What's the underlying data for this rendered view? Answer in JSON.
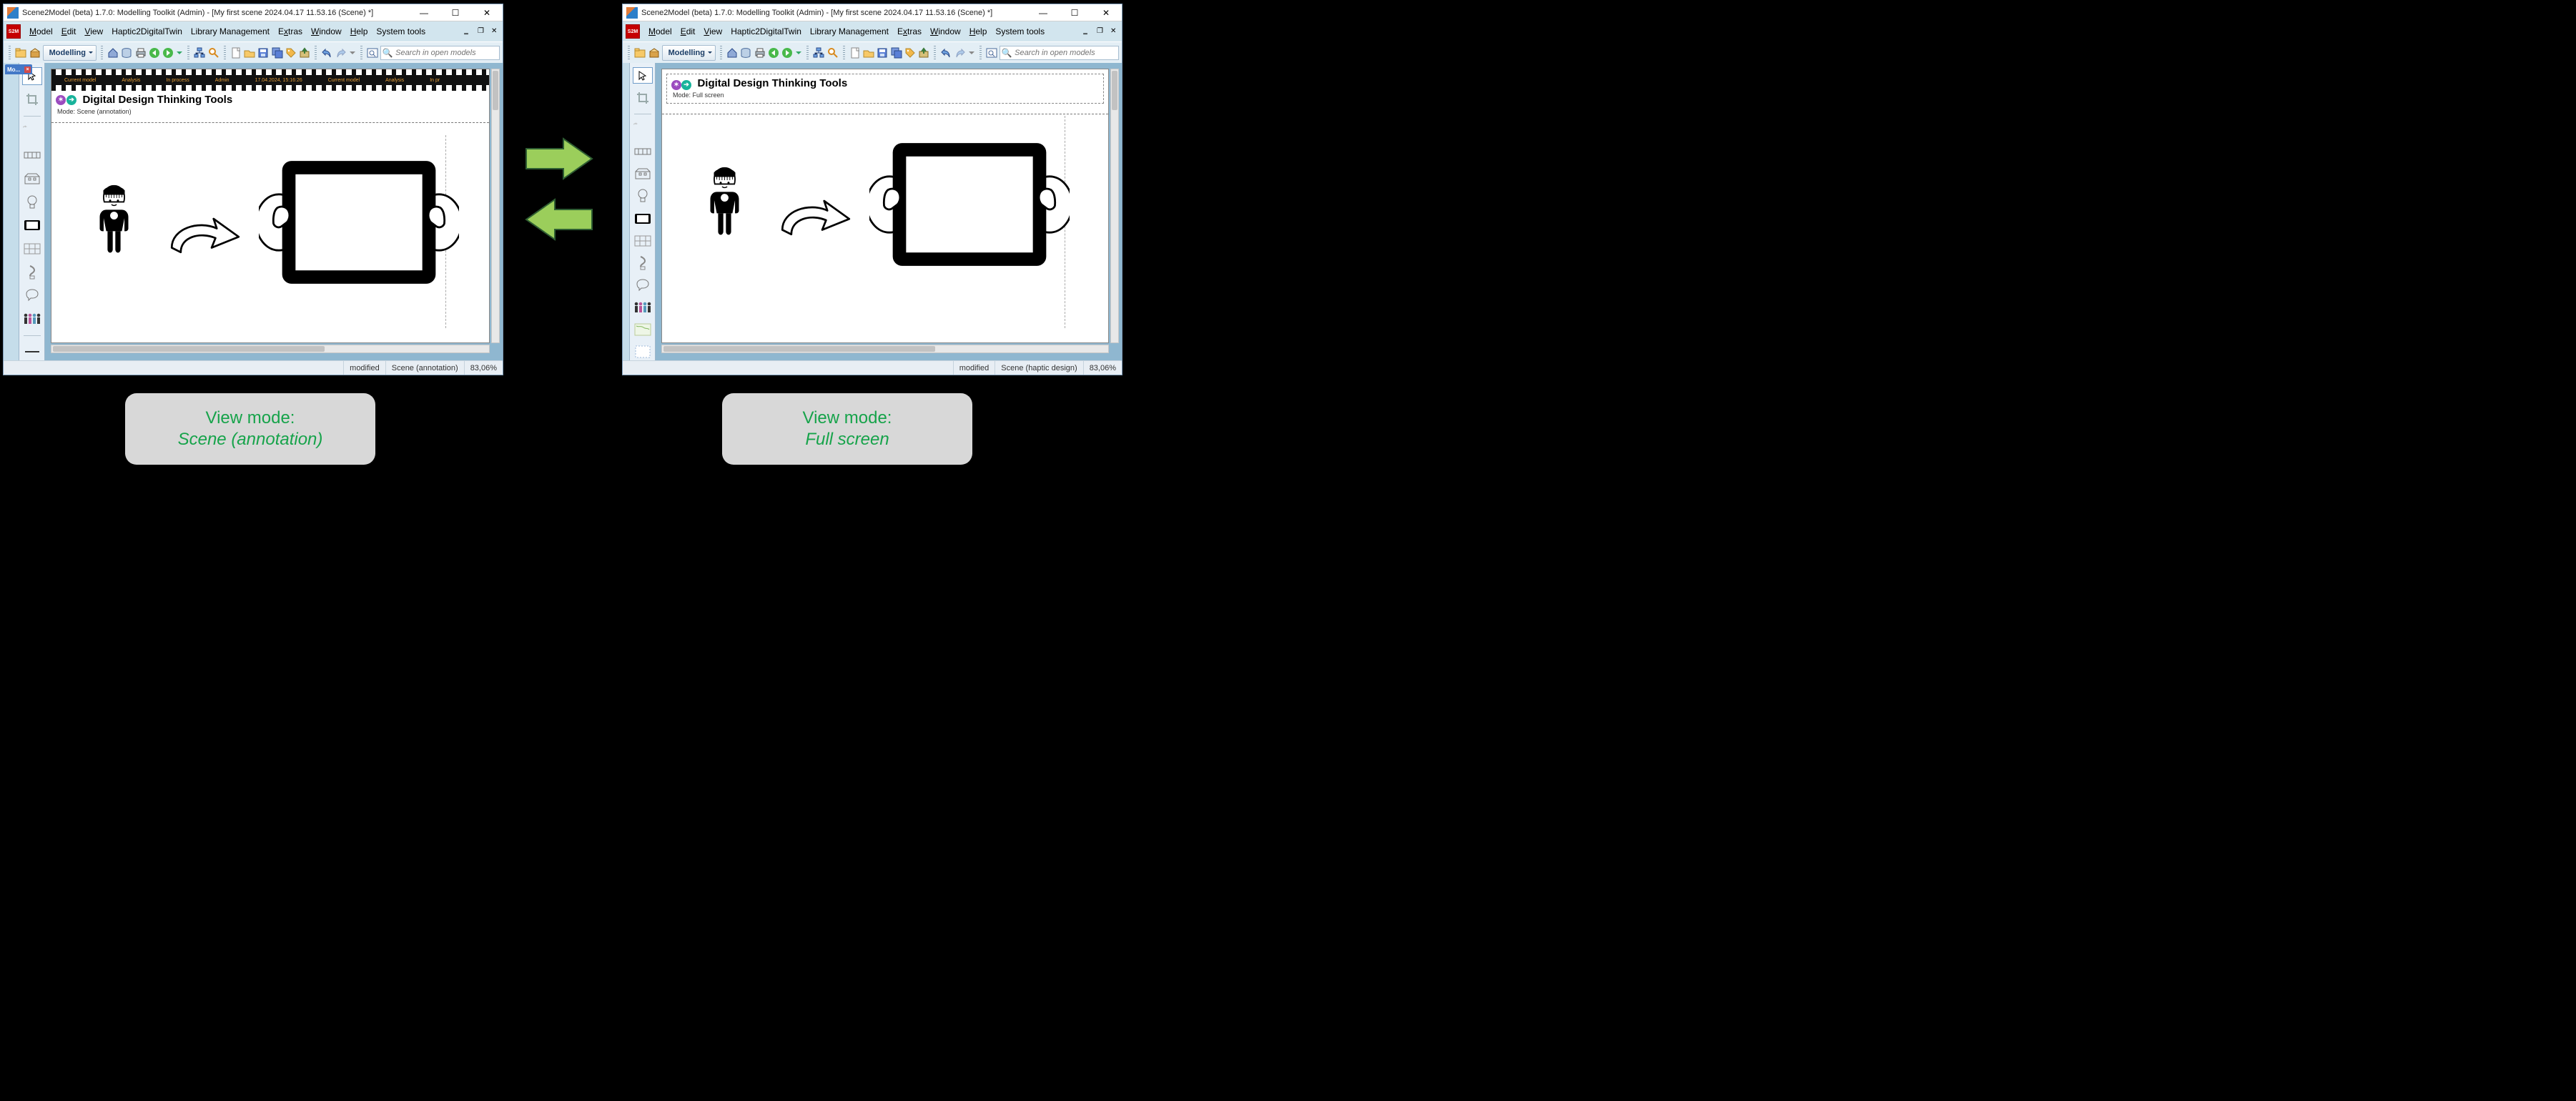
{
  "window_title": "Scene2Model (beta) 1.7.0: Modelling Toolkit (Admin) - [My first scene 2024.04.17 11.53.16 (Scene) *]",
  "logo_text": "S2M",
  "menus": {
    "model": "Model",
    "edit": "Edit",
    "view": "View",
    "haptic": "Haptic2DigitalTwin",
    "library": "Library Management",
    "extras": "Extras",
    "window": "Window",
    "help": "Help",
    "system": "System tools"
  },
  "modelling_label": "Modelling",
  "search_placeholder": "Search in open models",
  "doc_title": "Digital Design Thinking Tools",
  "mode_label_prefix": "Mode:",
  "left": {
    "mode_value": "Scene (annotation)",
    "film": {
      "f1": "Current model",
      "f2": "Analysis",
      "f3": "In process",
      "f4": "Admin",
      "f5": "17.04.2024, 15:16:26",
      "f6": "Current model",
      "f7": "Analysis",
      "f8": "In pr"
    },
    "status_modified": "modified",
    "status_mode": "Scene (annotation)",
    "status_zoom": "83,06%"
  },
  "right": {
    "mode_value": "Full screen",
    "status_modified": "modified",
    "status_mode": "Scene (haptic design)",
    "status_zoom": "83,06%"
  },
  "captions": {
    "heading": "View mode:",
    "left_value": "Scene (annotation)",
    "right_value": "Full screen"
  },
  "side_tab_label": "Mo..."
}
